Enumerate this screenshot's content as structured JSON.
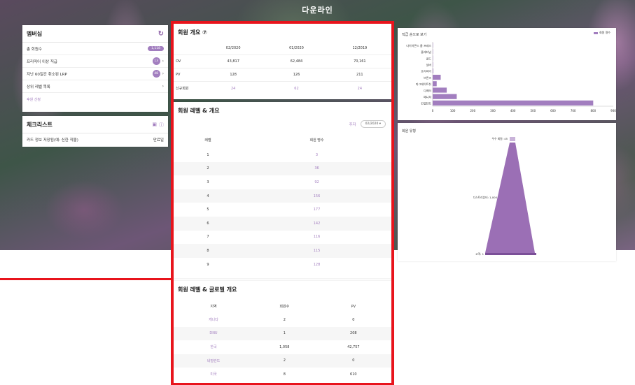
{
  "header": {
    "title": "다운라인"
  },
  "membership": {
    "title": "멤버십",
    "rows": [
      {
        "label": "총 회원수",
        "value": "1,118"
      },
      {
        "label": "프리미어 이상 직급",
        "value": "13"
      },
      {
        "label": "지난 60일간 취소된 LRP",
        "value": "48"
      },
      {
        "label": "상위 레벨 목록",
        "value": ""
      }
    ],
    "link": "후원 신청"
  },
  "checklist": {
    "title": "체크리스트",
    "item_label": "카드 정보 저장됨(예: 신한 직불)",
    "item_status": "만료일"
  },
  "overview": {
    "title": "회원 개요 ⑦",
    "columns": [
      "02/2020",
      "01/2020",
      "12/2019"
    ],
    "rows": [
      {
        "label": "OV",
        "values": [
          "43,817",
          "62,484",
          "70,161"
        ],
        "highlight": false
      },
      {
        "label": "PV",
        "values": [
          "128",
          "126",
          "211"
        ],
        "highlight": false
      },
      {
        "label": "신규회원",
        "values": [
          "24",
          "62",
          "24"
        ],
        "highlight": true
      }
    ]
  },
  "levels": {
    "title": "회원 레벨 & 개요",
    "filter_label": "주자",
    "filter_value": "02/2020 ▾",
    "headers": [
      "레벨",
      "회원 명수"
    ],
    "rows": [
      {
        "level": "1",
        "count": "3"
      },
      {
        "level": "2",
        "count": "36"
      },
      {
        "level": "3",
        "count": "92"
      },
      {
        "level": "4",
        "count": "156"
      },
      {
        "level": "5",
        "count": "177"
      },
      {
        "level": "6",
        "count": "142"
      },
      {
        "level": "7",
        "count": "116"
      },
      {
        "level": "8",
        "count": "115"
      },
      {
        "level": "9",
        "count": "128"
      }
    ]
  },
  "global": {
    "title": "회원 레벨 & 글로벌 개요",
    "headers": [
      "지역",
      "회원수",
      "PV"
    ],
    "rows": [
      {
        "region": "캐나다",
        "members": "2",
        "pv": "0"
      },
      {
        "region": "DNU",
        "members": "1",
        "pv": "208"
      },
      {
        "region": "한국",
        "members": "1,058",
        "pv": "42,757"
      },
      {
        "region": "네덜란드",
        "members": "2",
        "pv": "0"
      },
      {
        "region": "미국",
        "members": "8",
        "pv": "610"
      }
    ]
  },
  "chart_data": [
    {
      "type": "bar",
      "orientation": "horizontal",
      "title": "직급 순으로 보기",
      "legend": "회원 명수",
      "categories": [
        "다이아몬드 룸 프레스",
        "플래티넘",
        "골드",
        "실버",
        "프리미어",
        "브론즈",
        "마그레이트쉬",
        "디렉터",
        "매니저",
        "컨설턴트"
      ],
      "values": [
        1,
        1,
        1,
        2,
        3,
        40,
        20,
        70,
        120,
        800
      ],
      "xlim": [
        0,
        900
      ],
      "xticks": [
        "0",
        "100",
        "200",
        "300",
        "400",
        "500",
        "600",
        "700",
        "800",
        "900"
      ]
    },
    {
      "type": "funnel",
      "title": "회원 유형",
      "labels": [
        "우수 회원: 45",
        "디스트리뷰터: 1,000",
        "고객: 1"
      ]
    }
  ],
  "colors": {
    "accent": "#a27ebf",
    "highlight": "#e8141c"
  }
}
